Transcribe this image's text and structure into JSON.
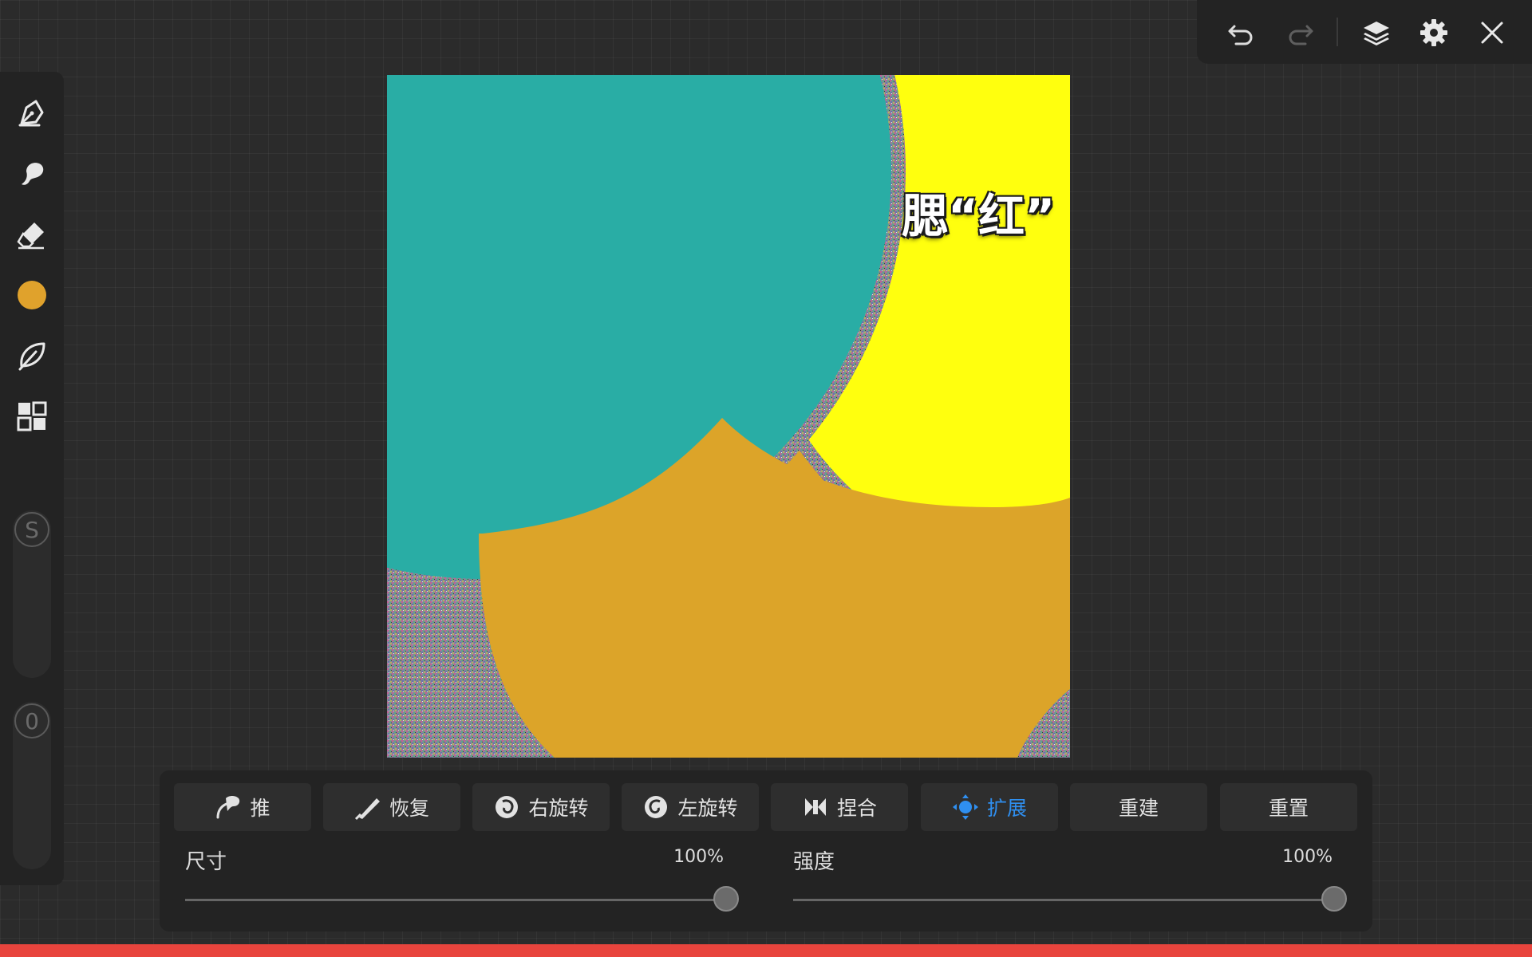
{
  "top_bar": {
    "icons": [
      "undo-icon",
      "redo-icon",
      "layers-icon",
      "gear-icon",
      "close-icon"
    ]
  },
  "left_bar": {
    "icons": [
      "pen-icon",
      "smudge-brush-icon",
      "eraser-icon",
      "color-icon",
      "leaf-icon",
      "grid-icon"
    ],
    "current_color": "#e0a22c",
    "size_slider_label": "S",
    "opacity_slider_label": "0"
  },
  "canvas": {
    "label_text": "腮“红”",
    "colors": {
      "teal": "#29ada5",
      "yellow": "#ffff0e",
      "orange": "#dca429"
    }
  },
  "tools": [
    {
      "label": "推",
      "icon": "push-icon",
      "active": false
    },
    {
      "label": "恢复",
      "icon": "restore-icon",
      "active": false
    },
    {
      "label": "右旋转",
      "icon": "twirl-right-icon",
      "active": false
    },
    {
      "label": "左旋转",
      "icon": "twirl-left-icon",
      "active": false
    },
    {
      "label": "捏合",
      "icon": "pinch-icon",
      "active": false
    },
    {
      "label": "扩展",
      "icon": "expand-icon",
      "active": true
    },
    {
      "label": "重建",
      "icon": "",
      "active": false
    },
    {
      "label": "重置",
      "icon": "",
      "active": false
    }
  ],
  "sliders": {
    "size": {
      "label": "尺寸",
      "value_text": "100%",
      "value": 1.0
    },
    "strength": {
      "label": "强度",
      "value_text": "100%",
      "value": 1.0
    }
  },
  "accent_color": "#2f8ff0"
}
